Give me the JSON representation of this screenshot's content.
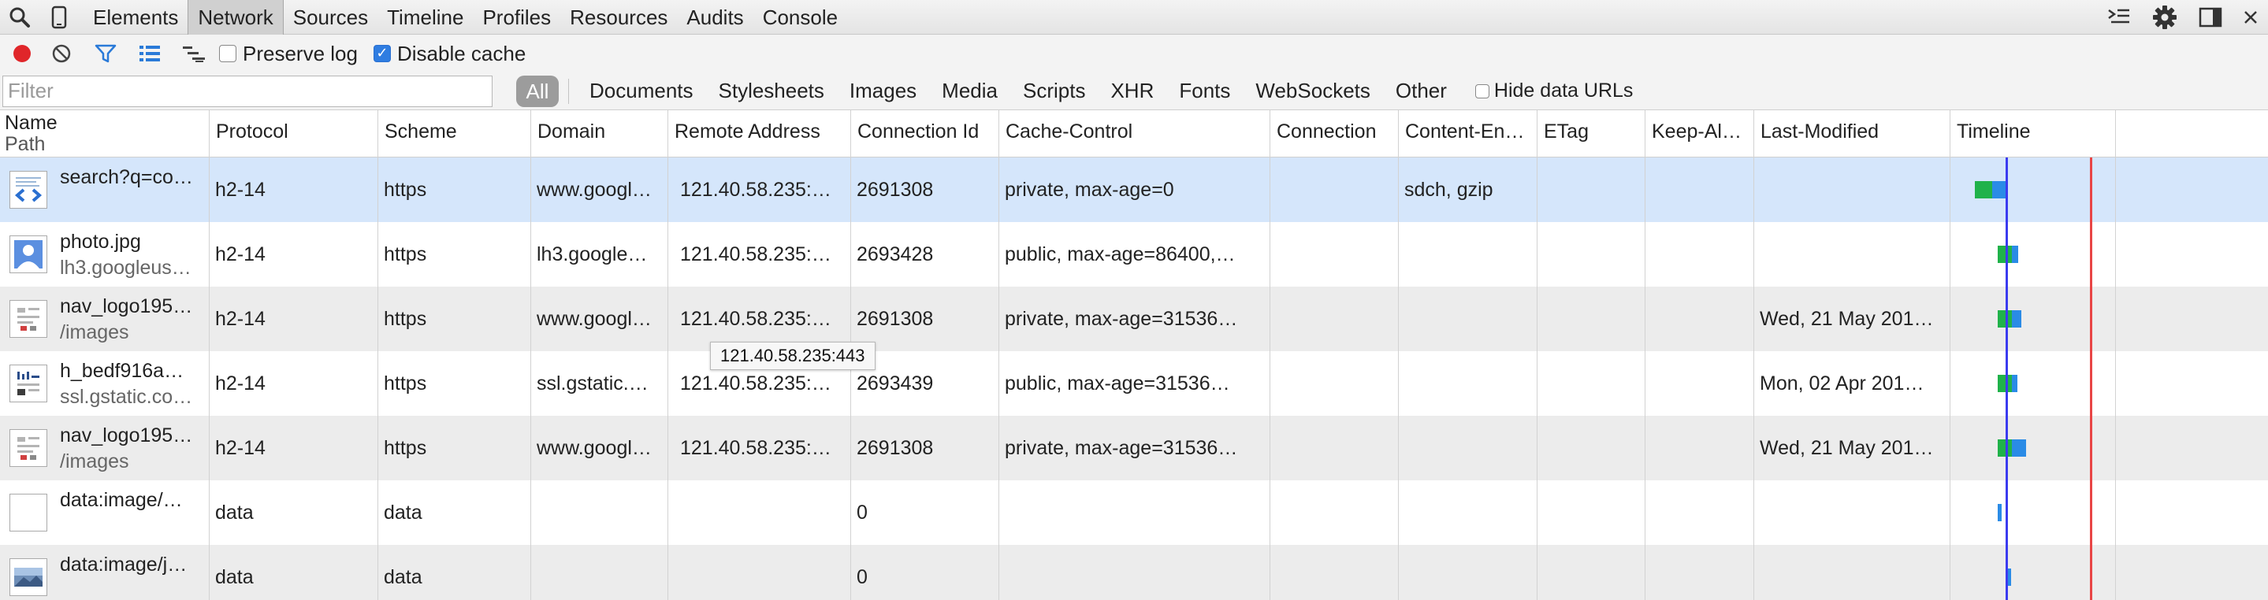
{
  "tabs": [
    "Elements",
    "Network",
    "Sources",
    "Timeline",
    "Profiles",
    "Resources",
    "Audits",
    "Console"
  ],
  "active_tab": "Network",
  "toolbar": {
    "preserve_log": "Preserve log",
    "preserve_log_checked": false,
    "disable_cache": "Disable cache",
    "disable_cache_checked": true
  },
  "filter": {
    "placeholder": "Filter",
    "value": "",
    "all": "All",
    "types": [
      "Documents",
      "Stylesheets",
      "Images",
      "Media",
      "Scripts",
      "XHR",
      "Fonts",
      "WebSockets",
      "Other"
    ],
    "hide_data_urls": "Hide data URLs"
  },
  "columns": {
    "name": "Name",
    "path": "Path",
    "protocol": "Protocol",
    "scheme": "Scheme",
    "domain": "Domain",
    "remote_address": "Remote Address",
    "connection_id": "Connection Id",
    "cache_control": "Cache-Control",
    "connection": "Connection",
    "content_encoding": "Content-En…",
    "etag": "ETag",
    "keep_alive": "Keep-Al…",
    "last_modified": "Last-Modified",
    "timeline": "Timeline"
  },
  "rows": [
    {
      "name": "search?q=co…",
      "path": "",
      "icon": "document-icon",
      "protocol": "h2-14",
      "scheme": "https",
      "domain": "www.googl…",
      "remote": "121.40.58.235:…",
      "conn_id": "2691308",
      "cache": "private, max-age=0",
      "connection": "",
      "encoding": "sdch, gzip",
      "etag": "",
      "keep": "",
      "last_modified": ""
    },
    {
      "name": "photo.jpg",
      "path": "lh3.googleus…",
      "icon": "photo-icon",
      "protocol": "h2-14",
      "scheme": "https",
      "domain": "lh3.google…",
      "remote": "121.40.58.235:…",
      "conn_id": "2693428",
      "cache": "public, max-age=86400,…",
      "connection": "",
      "encoding": "",
      "etag": "",
      "keep": "",
      "last_modified": ""
    },
    {
      "name": "nav_logo195…",
      "path": "/images",
      "icon": "image-icon",
      "protocol": "h2-14",
      "scheme": "https",
      "domain": "www.googl…",
      "remote": "121.40.58.235:…",
      "conn_id": "2691308",
      "cache": "private, max-age=31536…",
      "connection": "",
      "encoding": "",
      "etag": "",
      "keep": "",
      "last_modified": "Wed, 21 May 201…"
    },
    {
      "name": "h_bedf916a…",
      "path": "ssl.gstatic.co…",
      "icon": "image-icon",
      "protocol": "h2-14",
      "scheme": "https",
      "domain": "ssl.gstatic.…",
      "remote": "121.40.58.235:…",
      "conn_id": "2693439",
      "cache": "public, max-age=31536…",
      "connection": "",
      "encoding": "",
      "etag": "",
      "keep": "",
      "last_modified": "Mon, 02 Apr 201…"
    },
    {
      "name": "nav_logo195…",
      "path": "/images",
      "icon": "image-icon",
      "protocol": "h2-14",
      "scheme": "https",
      "domain": "www.googl…",
      "remote": "121.40.58.235:…",
      "conn_id": "2691308",
      "cache": "private, max-age=31536…",
      "connection": "",
      "encoding": "",
      "etag": "",
      "keep": "",
      "last_modified": "Wed, 21 May 201…"
    },
    {
      "name": "data:image/…",
      "path": "",
      "icon": "blank-icon",
      "protocol": "data",
      "scheme": "data",
      "domain": "",
      "remote": "",
      "conn_id": "0",
      "cache": "",
      "connection": "",
      "encoding": "",
      "etag": "",
      "keep": "",
      "last_modified": ""
    },
    {
      "name": "data:image/j…",
      "path": "",
      "icon": "landscape-icon",
      "protocol": "data",
      "scheme": "data",
      "domain": "",
      "remote": "",
      "conn_id": "0",
      "cache": "",
      "connection": "",
      "encoding": "",
      "etag": "",
      "keep": "",
      "last_modified": ""
    }
  ],
  "tooltip": "121.40.58.235:443",
  "colors": {
    "selected_row": "#d5e6fb",
    "alt_row": "#ececec",
    "record": "#e0262a",
    "checkbox": "#2f7de1",
    "waiting": "#20b24a",
    "receiving": "#2a8be6",
    "dom_line": "#3b3bf0",
    "load_line": "#e84545"
  }
}
